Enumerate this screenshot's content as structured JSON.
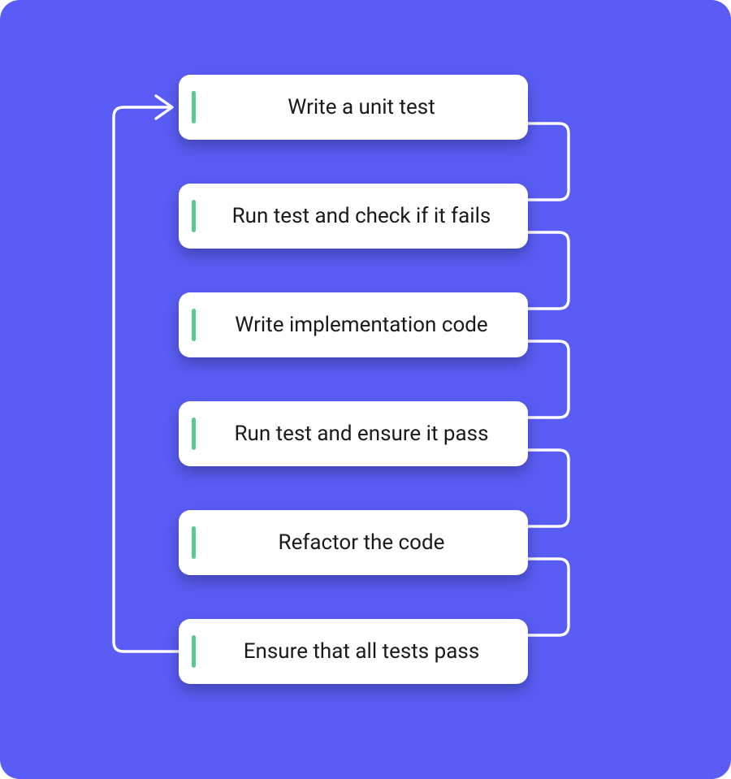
{
  "colors": {
    "background": "#5A5DF5",
    "card_bg": "#ffffff",
    "accent_bar": "#5ACB8F",
    "connector": "#ffffff",
    "text": "#1a1a1a"
  },
  "steps": [
    {
      "label": "Write a unit test"
    },
    {
      "label": "Run test and check if it fails"
    },
    {
      "label": "Write implementation code"
    },
    {
      "label": "Run test and ensure it pass"
    },
    {
      "label": "Refactor the code"
    },
    {
      "label": "Ensure that all tests pass"
    }
  ],
  "connections": {
    "forward_right": [
      {
        "from": 0,
        "to": 1
      },
      {
        "from": 1,
        "to": 2
      },
      {
        "from": 2,
        "to": 3
      },
      {
        "from": 3,
        "to": 4
      },
      {
        "from": 4,
        "to": 5
      }
    ],
    "loop_back": {
      "from": 5,
      "to": 0,
      "has_arrow": true
    }
  }
}
